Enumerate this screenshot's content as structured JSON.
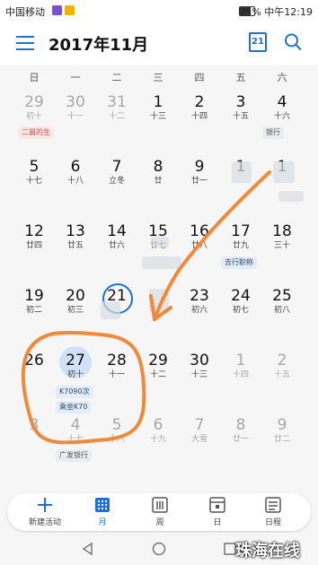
{
  "statusbar": {
    "carrier": "中国移动",
    "battery": "75%",
    "time": "中午12:19",
    "battery_level": 0.75
  },
  "header": {
    "title": "2017年11月",
    "today_icon_day": "21",
    "menu_icon": "menu-icon",
    "search_icon": "search-icon"
  },
  "weekdays": [
    "日",
    "一",
    "二",
    "三",
    "四",
    "五",
    "六"
  ],
  "weeks": [
    [
      {
        "d": "29",
        "l": "初十",
        "muted": true
      },
      {
        "d": "30",
        "l": "十一",
        "muted": true
      },
      {
        "d": "31",
        "l": "十二",
        "muted": true
      },
      {
        "d": "1",
        "l": "十三"
      },
      {
        "d": "2",
        "l": "十四"
      },
      {
        "d": "3",
        "l": "十五"
      },
      {
        "d": "4",
        "l": "十六"
      }
    ],
    [
      {
        "d": "5",
        "l": "十七"
      },
      {
        "d": "6",
        "l": "十八"
      },
      {
        "d": "7",
        "l": "立冬"
      },
      {
        "d": "8",
        "l": "廿"
      },
      {
        "d": "9",
        "l": "廿一"
      },
      {
        "d": "1",
        "l": ""
      },
      {
        "d": "1",
        "l": ""
      }
    ],
    [
      {
        "d": "12",
        "l": "廿四"
      },
      {
        "d": "13",
        "l": "廿五"
      },
      {
        "d": "14",
        "l": "廿六"
      },
      {
        "d": "15",
        "l": "廿七"
      },
      {
        "d": "16",
        "l": "廿八"
      },
      {
        "d": "17",
        "l": "廿九"
      },
      {
        "d": "18",
        "l": "三十"
      }
    ],
    [
      {
        "d": "19",
        "l": "初二"
      },
      {
        "d": "20",
        "l": "初三"
      },
      {
        "d": "21",
        "l": "",
        "today": true
      },
      {
        "d": "",
        "l": ""
      },
      {
        "d": "23",
        "l": "初六"
      },
      {
        "d": "24",
        "l": "初七"
      },
      {
        "d": "25",
        "l": "初八"
      }
    ],
    [
      {
        "d": "26",
        "l": ""
      },
      {
        "d": "27",
        "l": "初十",
        "selected": true
      },
      {
        "d": "28",
        "l": "十一"
      },
      {
        "d": "29",
        "l": "十二"
      },
      {
        "d": "30",
        "l": "十三"
      },
      {
        "d": "1",
        "l": "十四",
        "muted": true
      },
      {
        "d": "2",
        "l": "十五",
        "muted": true
      }
    ],
    [
      {
        "d": "3",
        "l": "",
        "muted": true
      },
      {
        "d": "4",
        "l": "十七",
        "muted": true
      },
      {
        "d": "5",
        "l": "十八",
        "muted": true
      },
      {
        "d": "6",
        "l": "十九",
        "muted": true
      },
      {
        "d": "7",
        "l": "大雪",
        "muted": true
      },
      {
        "d": "8",
        "l": "廿一",
        "muted": true
      },
      {
        "d": "9",
        "l": "廿二",
        "muted": true
      }
    ]
  ],
  "events": {
    "birthday": "二舅的生",
    "bank_w1": "银行",
    "work_w3": "去行职称",
    "train1": "K7090次",
    "train2": "乘坐K70",
    "bank_w6": "广发银行"
  },
  "bottom_nav": [
    {
      "label": "新建活动",
      "icon": "plus-icon"
    },
    {
      "label": "月",
      "icon": "month-grid-icon",
      "active": true
    },
    {
      "label": "周",
      "icon": "week-icon"
    },
    {
      "label": "日",
      "icon": "day-icon"
    },
    {
      "label": "日程",
      "icon": "agenda-icon"
    }
  ],
  "watermark": "珠海在线",
  "colors": {
    "accent": "#1e6fd8",
    "selected": "#cfe2f7",
    "annotation": "#f0893a"
  }
}
